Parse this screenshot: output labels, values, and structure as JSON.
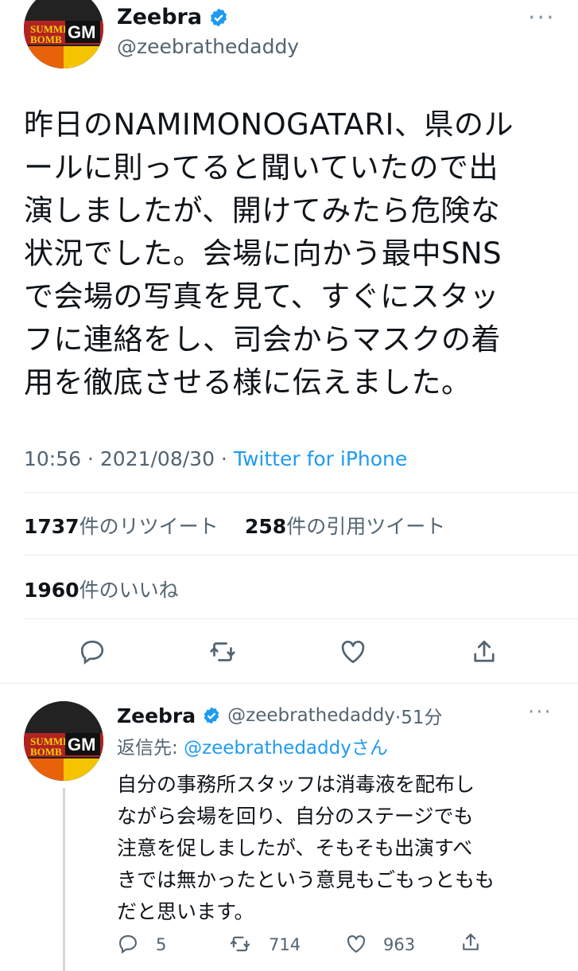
{
  "tweet": {
    "author_name": "Zeebra",
    "author_handle": "@zeebrathedaddy",
    "avatar_text": "SUMMER BOMB GM",
    "text": "昨日のNAMIMONOGATARI、県のルールに則ってると聞いていたので出演しましたが、開けてみたら危険な状況でした。会場に向かう最中SNSで会場の写真を見て、すぐにスタッフに連絡をし、司会からマスクの着用を徹底させる様に伝えました。",
    "text_lines": [
      "昨日のNAMIMONOGATARI、県のル",
      "ールに則ってると聞いていたので出",
      "演しましたが、開けてみたら危険な",
      "状況でした。会場に向かう最中SNS",
      "で会場の写真を見て、すぐにスタッ",
      "フに連絡をし、司会からマスクの着",
      "用を徹底させる様に伝えました。"
    ],
    "time": "10:56 · 2021/08/30 · ",
    "app": "Twitter for iPhone",
    "retweets_count": "1737",
    "retweets_label": "件のリツイート",
    "quotes_count": "258",
    "quotes_label": "件の引用ツイート",
    "likes_count": "1960",
    "likes_label": "件のいいね",
    "actions": [
      "reply-icon",
      "retweet-icon",
      "like-icon",
      "share-icon"
    ]
  },
  "reply": {
    "author_name": "Zeebra",
    "author_handle": "@zeebrathedaddy",
    "time_ago": "·51分",
    "replying_prefix": "返信先: ",
    "replying_to": "@zeebrathedaddy",
    "replying_suffix": "さん",
    "text_lines": [
      "自分の事務所スタッフは消毒液を配布し",
      "ながら会場を回り、自分のステージでも",
      "注意を促しましたが、そもそも出演すべ",
      "きでは無かったという意見もごもっともも",
      "だと思います。"
    ],
    "reply_count": "5",
    "retweet_count": "714",
    "like_count": "963"
  },
  "colors": {
    "text": "#0f1419",
    "secondary": "#536471",
    "accent": "#1d9bf0",
    "divider": "#e6ecf0"
  }
}
